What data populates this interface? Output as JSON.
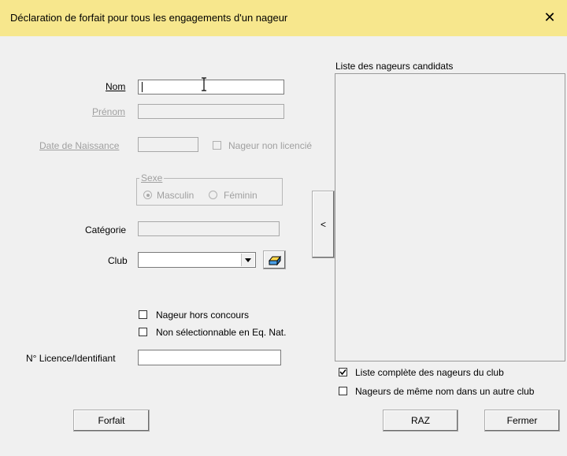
{
  "window": {
    "title": "Déclaration de forfait pour tous les engagements d'un nageur",
    "close_glyph": "✕"
  },
  "form": {
    "nom_label": "Nom",
    "nom_value": "",
    "prenom_label": "Prénom",
    "date_label": "Date de Naissance",
    "non_licencie_label": "Nageur non licencié",
    "sexe_label": "Sexe",
    "masculin_label": "Masculin",
    "feminin_label": "Féminin",
    "categorie_label": "Catégorie",
    "club_label": "Club",
    "club_value": "",
    "hors_concours_label": "Nageur hors concours",
    "non_selectionnable_label": "Non sélectionnable en Eq. Nat.",
    "licence_label": "N° Licence/Identifiant",
    "licence_value": ""
  },
  "list": {
    "title": "Liste des nageurs candidats",
    "items": [],
    "transfer_button": "<"
  },
  "options": {
    "liste_complete_label": "Liste complète des nageurs du club",
    "liste_complete_checked": true,
    "meme_nom_label": "Nageurs de même nom dans un autre club",
    "meme_nom_checked": false
  },
  "buttons": {
    "forfait": "Forfait",
    "raz": "RAZ",
    "fermer": "Fermer"
  },
  "icons": {
    "club_search": "drawer-icon",
    "dropdown": "chevron-down-icon",
    "cursor": "text-cursor-icon"
  }
}
